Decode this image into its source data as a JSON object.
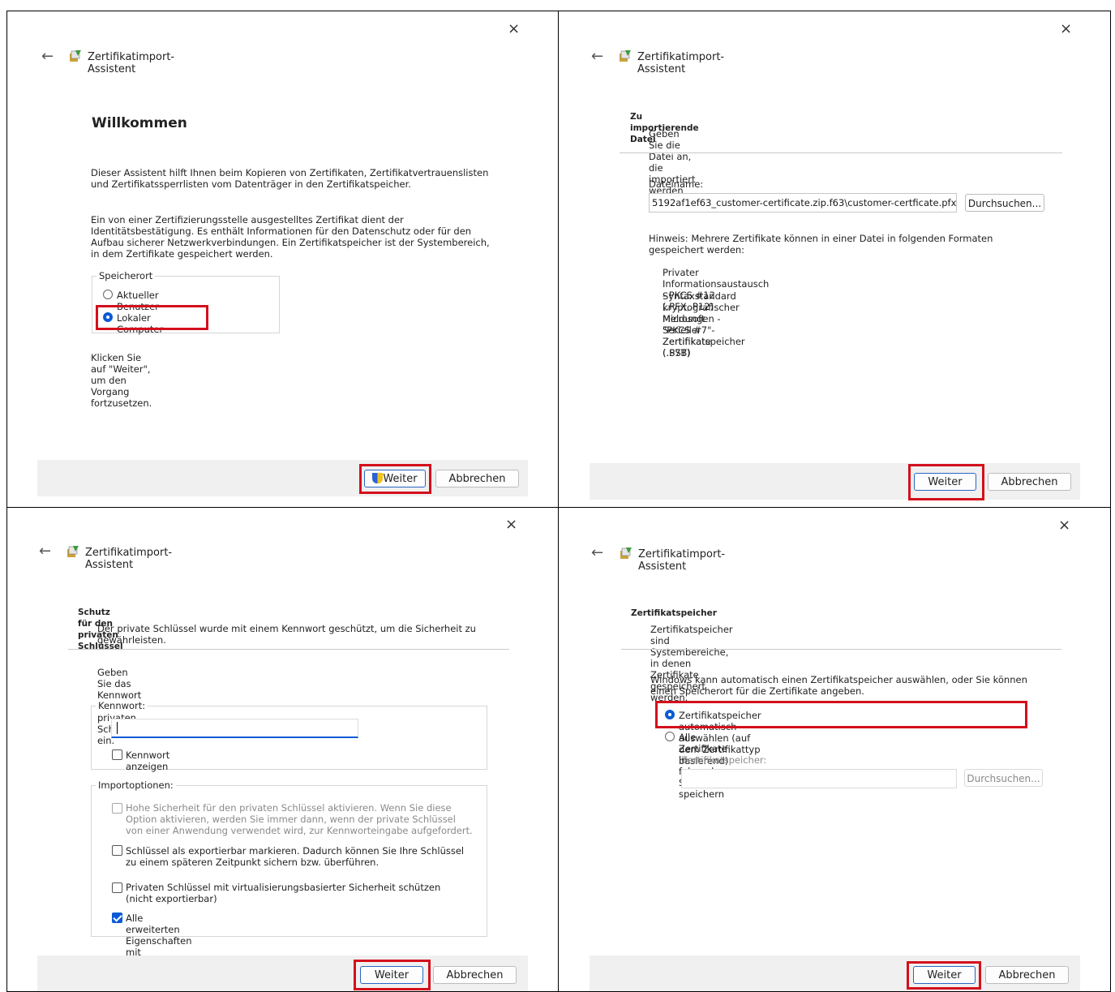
{
  "common": {
    "wizard_title": "Zertifikatimport-Assistent",
    "next_label": "Weiter",
    "cancel_label": "Abbrechen",
    "close_glyph": "×",
    "back_glyph": "←"
  },
  "panel1": {
    "heading": "Willkommen",
    "intro": "Dieser Assistent hilft Ihnen beim Kopieren von Zertifikaten, Zertifikatvertrauenslisten und Zertifikatssperrlisten vom Datenträger in den Zertifikatspeicher.",
    "info": "Ein von einer Zertifizierungsstelle ausgestelltes Zertifikat dient der Identitätsbestätigung. Es enthält Informationen für den Datenschutz oder für den Aufbau sicherer Netzwerkverbindungen. Ein Zertifikatspeicher ist der Systembereich, in dem Zertifikate gespeichert werden.",
    "store_group": "Speicherort",
    "option_current_user": "Aktueller Benutzer",
    "option_local_machine": "Lokaler Computer",
    "continue_hint": "Klicken Sie auf \"Weiter\", um den Vorgang fortzusetzen."
  },
  "panel2": {
    "section_title": "Zu importierende Datei",
    "section_sub": "Geben Sie die Datei an, die importiert werden soll.",
    "filename_label": "Dateiname:",
    "filename_value": "5192af1ef63_customer-certificate.zip.f63\\customer-certficate.pfx",
    "browse_label": "Durchsuchen...",
    "note": "Hinweis: Mehrere Zertifikate können in einer Datei in folgenden Formaten gespeichert werden:",
    "formats": [
      "Privater Informationsaustausch - PKCS #12 (.PFX,.P12)",
      "Syntaxstandard kryptografischer Meldungen - \"PKCS #7\"-Zertifikate (.P7B)",
      "Microsoft Serieller Zertifikatspeicher (.SST)"
    ]
  },
  "panel3": {
    "section_title": "Schutz für den privaten Schlüssel",
    "section_sub": "Der private Schlüssel wurde mit einem Kennwort geschützt, um die Sicherheit zu gewährleisten.",
    "prompt": "Geben Sie das Kennwort für den privaten Schlüssel ein.",
    "password_group": "Kennwort:",
    "show_password": "Kennwort anzeigen",
    "import_group": "Importoptionen:",
    "opt_high_security": "Hohe Sicherheit für den privaten Schlüssel aktivieren. Wenn Sie diese Option aktivieren, werden Sie immer dann, wenn der private Schlüssel von einer Anwendung verwendet wird, zur Kennworteingabe aufgefordert.",
    "opt_exportable": "Schlüssel als exportierbar markieren. Dadurch können Sie Ihre Schlüssel zu einem späteren Zeitpunkt sichern bzw. überführen.",
    "opt_virtualization": "Privaten Schlüssel mit virtualisierungsbasierter Sicherheit schützen (nicht exportierbar)",
    "opt_extended": "Alle erweiterten Eigenschaften mit einbeziehen"
  },
  "panel4": {
    "section_title": "Zertifikatspeicher",
    "section_sub": "Zertifikatspeicher sind Systembereiche, in denen Zertifikate gespeichert werden.",
    "info": "Windows kann automatisch einen Zertifikatspeicher auswählen, oder Sie können einen Speicherort für die Zertifikate angeben.",
    "option_auto": "Zertifikatspeicher automatisch auswählen (auf dem Zertifikattyp basierend)",
    "option_manual": "Alle Zertifikate in folgendem Speicher speichern",
    "store_label": "Zertifikatspeicher:",
    "browse_label": "Durchsuchen..."
  },
  "colors": {
    "highlight": "#d40f1c",
    "accent": "#0a5bd4",
    "footer": "#f0f0f0"
  }
}
